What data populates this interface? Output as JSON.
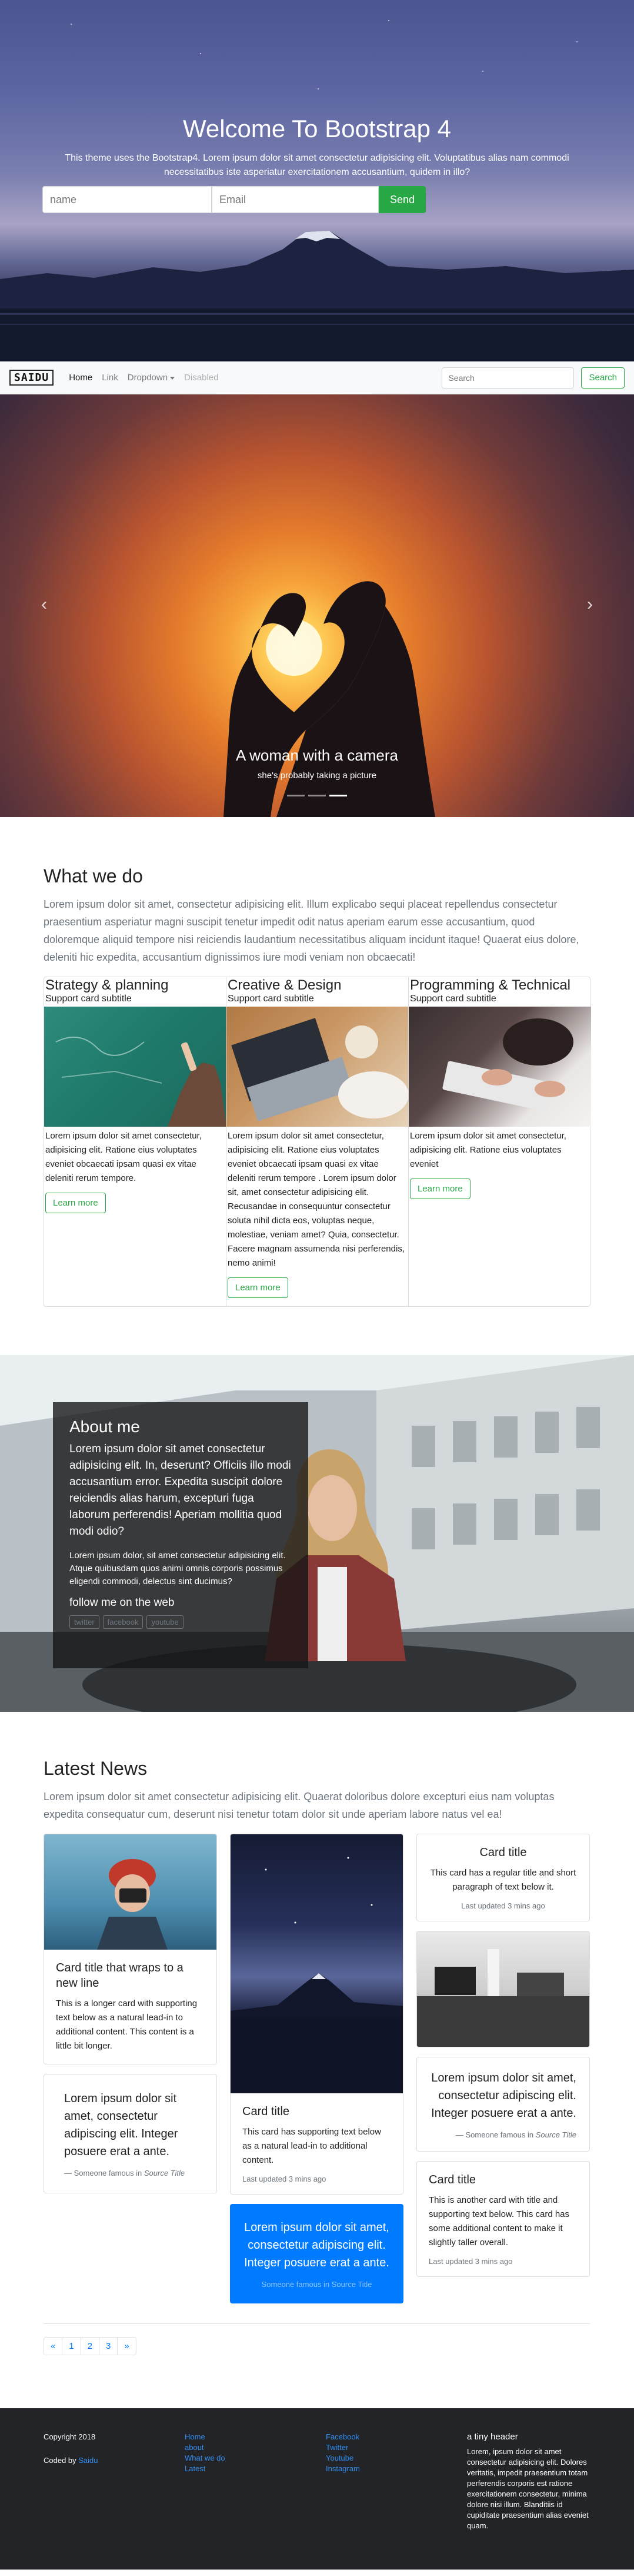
{
  "hero": {
    "title": "Welcome To Bootstrap 4",
    "subtitle": "This theme uses the Bootstrap4. Lorem ipsum dolor sit amet consectetur adipisicing elit. Voluptatibus alias nam commodi necessitatibus iste asperiatur exercitationem accusantium, quidem in illo?",
    "name_placeholder": "name",
    "email_placeholder": "Email",
    "send_label": "Send"
  },
  "navbar": {
    "brand": "SAIDU",
    "links": {
      "home": "Home",
      "link": "Link",
      "dropdown": "Dropdown",
      "disabled": "Disabled"
    },
    "search_placeholder": "Search",
    "search_button": "Search"
  },
  "carousel": {
    "prev_icon": "‹",
    "next_icon": "›",
    "caption_title": "A woman with a camera",
    "caption_text": "she's probably taking a picture",
    "active_slide": 3,
    "slide_count": 3
  },
  "what_we_do": {
    "title": "What we do",
    "lead": "Lorem ipsum dolor sit amet, consectetur adipisicing elit. Illum explicabo sequi placeat repellendus consectetur praesentium asperiatur magni suscipit tenetur impedit odit natus aperiam earum esse accusantium, quod doloremque aliquid tempore nisi reiciendis laudantium necessitatibus aliquam incidunt itaque! Quaerat eius dolore, deleniti hic expedita, accusantium dignissimos iure modi veniam non obcaecati!",
    "cards": [
      {
        "title": "Strategy & planning",
        "subtitle": "Support card subtitle",
        "body": "Lorem ipsum dolor sit amet consectetur, adipisicing elit. Ratione eius voluptates eveniet obcaecati ipsam quasi ex vitae deleniti rerum tempore.",
        "button": "Learn more"
      },
      {
        "title": "Creative & Design",
        "subtitle": "Support card subtitle",
        "body": "Lorem ipsum dolor sit amet consectetur, adipisicing elit. Ratione eius voluptates eveniet obcaecati ipsam quasi ex vitae deleniti rerum tempore . Lorem ipsum dolor sit, amet consectetur adipisicing elit. Recusandae in consequuntur consectetur soluta nihil dicta eos, voluptas neque, molestiae, veniam amet? Quia, consectetur. Facere magnam assumenda nisi perferendis, nemo animi!",
        "button": "Learn more"
      },
      {
        "title": "Programming & Technical",
        "subtitle": "Support card subtitle",
        "body": "Lorem ipsum dolor sit amet consectetur, adipisicing elit. Ratione eius voluptates eveniet",
        "button": "Learn more"
      }
    ]
  },
  "about": {
    "title": "About me",
    "p1": "Lorem ipsum dolor sit amet consectetur adipisicing elit. In, deserunt? Officiis illo modi accusantium error. Expedita suscipit dolore reiciendis alias harum, excepturi fuga laborum perferendis! Aperiam mollitia quod modi odio?",
    "p2": "Lorem ipsum dolor, sit amet consectetur adipisicing elit. Atque quibusdam quos animi omnis corporis possimus eligendi commodi, delectus sint ducimus?",
    "follow": "follow me on the web",
    "social": [
      "twitter",
      "facebook",
      "youtube"
    ]
  },
  "news": {
    "title": "Latest News",
    "lead": "Lorem ipsum dolor sit amet consectetur adipisicing elit. Quaerat doloribus dolore excepturi eius nam voluptas expedita consequatur cum, deserunt nisi tenetur totam dolor sit unde aperiam labore natus vel ea!",
    "card1": {
      "title": "Card title that wraps to a new line",
      "text": "This is a longer card with supporting text below as a natural lead-in to additional content. This content is a little bit longer."
    },
    "quote1": {
      "text": "Lorem ipsum dolor sit amet, consectetur adipiscing elit. Integer posuere erat a ante.",
      "footer_prefix": "Someone famous in ",
      "source": "Source Title"
    },
    "card2": {
      "title": "Card title",
      "text": "This card has supporting text below as a natural lead-in to additional content.",
      "meta": "Last updated 3 mins ago"
    },
    "quote_blue": {
      "text": "Lorem ipsum dolor sit amet, consectetur adipiscing elit. Integer posuere erat a ante.",
      "footer": "Someone famous in Source Title"
    },
    "card3": {
      "title": "Card title",
      "text": "This card has a regular title and short paragraph of text below it.",
      "meta": "Last updated 3 mins ago"
    },
    "quote2": {
      "text": "Lorem ipsum dolor sit amet, consectetur adipiscing elit. Integer posuere erat a ante.",
      "footer_prefix": "Someone famous in ",
      "source": "Source Title"
    },
    "card4": {
      "title": "Card title",
      "text": "This is another card with title and supporting text below. This card has some additional content to make it slightly taller overall.",
      "meta": "Last updated 3 mins ago"
    },
    "pagination": [
      "«",
      "1",
      "2",
      "3",
      "»"
    ]
  },
  "footer": {
    "copyright": "Copyright 2018",
    "coded_prefix": "Coded by ",
    "coded_name": "Saidu",
    "links1": [
      "Home",
      "about",
      "What we do",
      "Latest"
    ],
    "links2": [
      "Facebook",
      "Twitter",
      "Youtube",
      "Instagram"
    ],
    "header": "a tiny header",
    "text": "Lorem, ipsum dolor sit amet consectetur adipisicing elit. Dolores veritatis, impedit praesentium totam perferendis corporis est ratione exercitationem consectetur, minima dolore nisi illum. Blanditiis id cupiditate praesentium alias eveniet quam."
  },
  "colors": {
    "primary": "#007bff",
    "success": "#28a745",
    "footer_bg": "#222428",
    "muted": "#6c757d"
  }
}
